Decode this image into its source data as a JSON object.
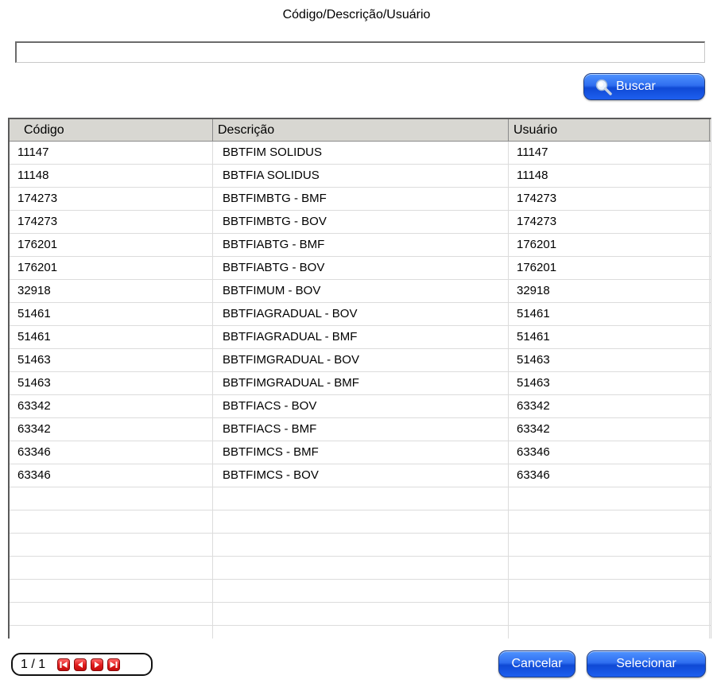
{
  "search": {
    "label": "Código/Descrição/Usuário",
    "value": "",
    "button_label": "Buscar"
  },
  "table": {
    "headers": [
      "Código",
      "Descrição",
      "Usuário"
    ],
    "rows": [
      [
        "11147",
        "BBTFIM SOLIDUS",
        "11147"
      ],
      [
        "11148",
        "BBTFIA SOLIDUS",
        "11148"
      ],
      [
        "174273",
        "BBTFIMBTG - BMF",
        "174273"
      ],
      [
        "174273",
        "BBTFIMBTG - BOV",
        "174273"
      ],
      [
        "176201",
        "BBTFIABTG - BMF",
        "176201"
      ],
      [
        "176201",
        "BBTFIABTG - BOV",
        "176201"
      ],
      [
        "32918",
        "BBTFIMUM - BOV",
        "32918"
      ],
      [
        "51461",
        "BBTFIAGRADUAL - BOV",
        "51461"
      ],
      [
        "51461",
        "BBTFIAGRADUAL - BMF",
        "51461"
      ],
      [
        "51463",
        "BBTFIMGRADUAL - BOV",
        "51463"
      ],
      [
        "51463",
        "BBTFIMGRADUAL - BMF",
        "51463"
      ],
      [
        "63342",
        "BBTFIACS - BOV",
        "63342"
      ],
      [
        "63342",
        "BBTFIACS - BMF",
        "63342"
      ],
      [
        "63346",
        "BBTFIMCS - BMF",
        "63346"
      ],
      [
        "63346",
        "BBTFIMCS - BOV",
        "63346"
      ]
    ],
    "empty_rows": 7
  },
  "pager": {
    "text": "1 / 1",
    "icons": [
      "first-page-icon",
      "prev-page-icon",
      "next-page-icon",
      "last-page-icon"
    ]
  },
  "actions": {
    "cancel_label": "Cancelar",
    "select_label": "Selecionar"
  },
  "colors": {
    "button_blue": "#2f6ef0",
    "pager_red": "#e31e1e",
    "header_bg": "#d8d7d2"
  }
}
